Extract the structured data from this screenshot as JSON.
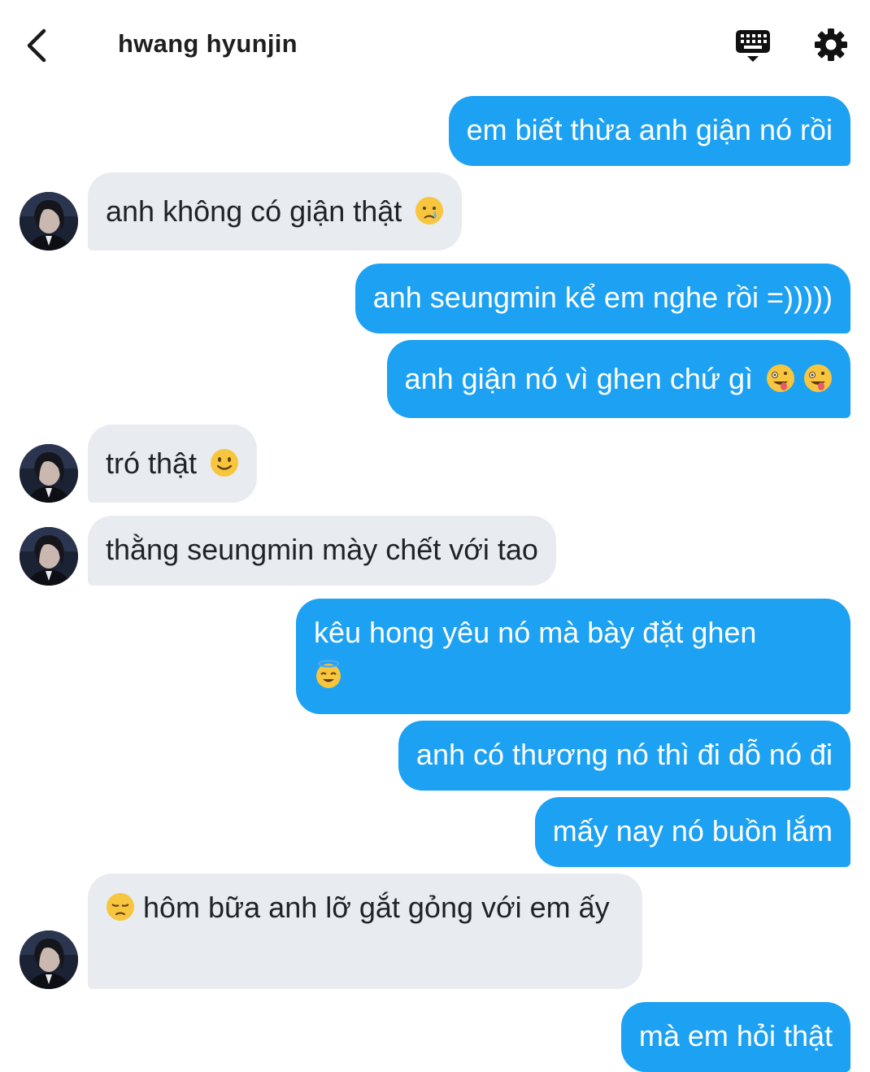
{
  "header": {
    "title": "hwang hyunjin",
    "back_icon": "chevron-left-icon",
    "keyboard_icon": "keyboard-icon",
    "settings_icon": "gear-icon"
  },
  "colors": {
    "outgoing_bubble": "#1da1f2",
    "incoming_bubble": "#e8ecf0",
    "outgoing_text": "#ffffff",
    "incoming_text": "#1f2328"
  },
  "messages": [
    {
      "side": "out",
      "text": "em biết thừa anh giận nó rồi"
    },
    {
      "side": "in",
      "text": "anh không có giận thật",
      "emoji": "crying-face-icon"
    },
    {
      "side": "out",
      "text": "anh seungmin kể em nghe rồi =)))))"
    },
    {
      "side": "out",
      "text": "anh giận nó vì ghen chứ gì",
      "emoji": "zany-face-icon x2"
    },
    {
      "side": "in",
      "text": "tró thật",
      "emoji": "slightly-smiling-face-icon"
    },
    {
      "side": "in",
      "text": "thằng seungmin mày chết với tao"
    },
    {
      "side": "out",
      "text": "kêu hong yêu nó mà bày đặt ghen",
      "emoji": "smiling-face-with-halo-icon"
    },
    {
      "side": "out",
      "text": "anh có thương nó thì đi dỗ nó đi"
    },
    {
      "side": "out",
      "text": "mấy nay nó buồn lắm"
    },
    {
      "side": "in",
      "text": "hôm bữa anh lỡ gắt gỏng với em ấy",
      "emoji": "pensive-face-icon"
    },
    {
      "side": "out",
      "text": "mà em hỏi thật"
    }
  ]
}
